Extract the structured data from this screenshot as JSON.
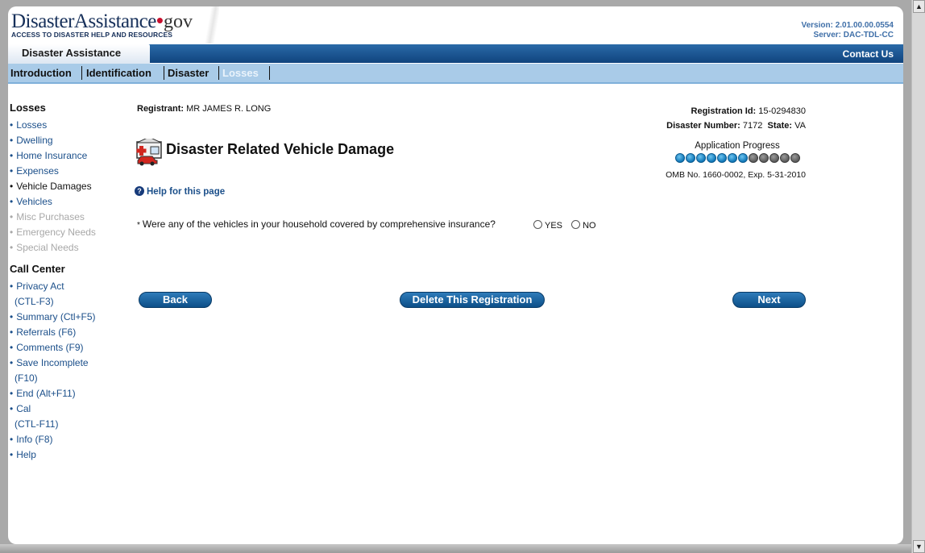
{
  "header": {
    "logo_brand": "DisasterAssistance",
    "logo_dot": "•",
    "logo_gov": "gov",
    "logo_tagline": "ACCESS TO DISASTER HELP AND RESOURCES",
    "version": "Version: 2.01.00.00.0554",
    "server": "Server: DAC-TDL-CC",
    "app_title": "Disaster Assistance",
    "contact": "Contact Us"
  },
  "tabs": [
    {
      "label": "Introduction",
      "active": false
    },
    {
      "label": "Identification",
      "active": false
    },
    {
      "label": "Disaster",
      "active": false
    },
    {
      "label": "Losses",
      "active": true
    }
  ],
  "sidebar": {
    "losses_heading": "Losses",
    "losses_items": [
      {
        "label": "Losses",
        "state": "link"
      },
      {
        "label": "Dwelling",
        "state": "link"
      },
      {
        "label": "Home Insurance",
        "state": "link"
      },
      {
        "label": "Expenses",
        "state": "link"
      },
      {
        "label": "Vehicle Damages",
        "state": "current"
      },
      {
        "label": "Vehicles",
        "state": "link"
      },
      {
        "label": "Misc Purchases",
        "state": "disabled"
      },
      {
        "label": "Emergency Needs",
        "state": "disabled"
      },
      {
        "label": "Special Needs",
        "state": "disabled"
      }
    ],
    "callcenter_heading": "Call Center",
    "callcenter_items": {
      "privacy": "Privacy Act",
      "privacy_key": "(CTL-F3)",
      "summary": "Summary (Ctl+F5)",
      "referrals": "Referrals (F6)",
      "comments": "Comments (F9)",
      "save": "Save Incomplete",
      "save_key": "(F10)",
      "end": "End (Alt+F11)",
      "cal": "Cal",
      "cal_key": "(CTL-F11)",
      "info": "Info (F8)",
      "help": "Help"
    },
    "bullet": "•"
  },
  "main": {
    "registrant_label": "Registrant:",
    "registrant_value": "MR JAMES R. LONG",
    "registration_id_label": "Registration Id:",
    "registration_id_value": "15-0294830",
    "disaster_number_label": "Disaster Number:",
    "disaster_number_value": "7172",
    "state_label": "State:",
    "state_value": "VA",
    "page_title": "Disaster Related Vehicle Damage",
    "progress_label": "Application Progress",
    "progress_completed": 7,
    "progress_total": 12,
    "omb": "OMB No. 1660-0002, Exp. 5-31-2010",
    "help_link": "Help for this page",
    "help_icon": "?",
    "question_star": "*",
    "question": "Were any of the vehicles in your household covered by comprehensive insurance?",
    "yes_label": "YES",
    "no_label": "NO"
  },
  "buttons": {
    "back": "Back",
    "delete": "Delete This Registration",
    "next": "Next"
  },
  "colors": {
    "link": "#1b4f8a",
    "header_bar": "#10447e",
    "tab_bar": "#a9cbe8",
    "button": "#0c4f88"
  },
  "icons": {
    "page_icon": "house-car-damage-icon",
    "help_icon": "question-circle-icon"
  }
}
